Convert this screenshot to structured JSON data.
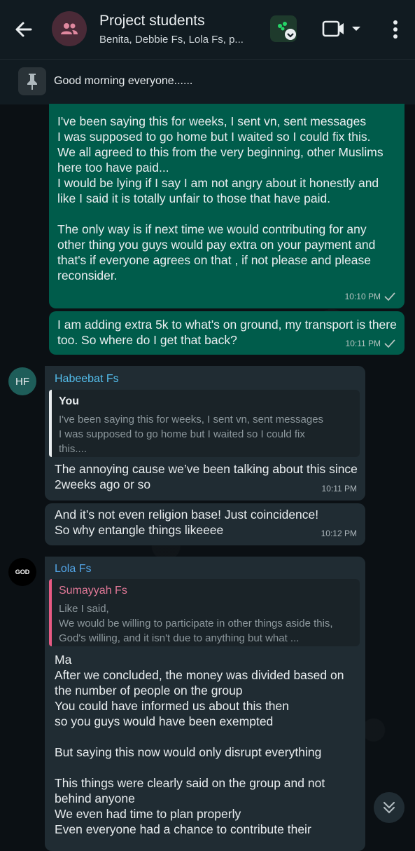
{
  "header": {
    "title": "Project students",
    "participants": "Benita, Debbie Fs, Lola Fs, p..."
  },
  "pinned": {
    "text": "Good morning everyone......"
  },
  "messages": {
    "out1": {
      "text": "I've been saying this for weeks, I sent vn, sent messages\nI was supposed to go home but I waited so I could fix this.\nWe all agreed to this from the very beginning, other Muslims here too have paid...\nI would be lying if I say I am not angry about it honestly and like I said it is totally unfair to those that have paid.\n\nThe only way is if next time we would contributing for any other thing you guys would pay extra on your payment and that's if everyone agrees on that , if not please and please reconsider.",
      "time": "10:10 PM"
    },
    "out2": {
      "text": "I am adding extra 5k to what's on ground, my transport is there too. So where do I get that back?",
      "time": "10:11 PM"
    },
    "in1": {
      "avatar": "HF",
      "sender": "Habeebat Fs",
      "quote_name": "You",
      "quote_text": "I've been saying this for weeks, I sent vn, sent messages\nI was supposed to go home but I waited so I could fix\nthis....",
      "text": "The annoying cause we’ve been talking about this since 2weeks ago or so",
      "time": "10:11 PM"
    },
    "in2": {
      "text": "And it’s not even religion base! Just coincidence!\nSo why entangle things likeeee",
      "time": "10:12 PM"
    },
    "in3": {
      "avatar": "GOD",
      "sender": "Lola Fs",
      "quote_name": "Sumayyah Fs",
      "quote_text": "Like I said,\nWe would be willing to participate in other things aside this, God's willing, and it isn't due to anything but what ...",
      "text": "Ma\nAfter we concluded, the money was divided based on the number of people on the group\nYou could have informed us about this then\nso you guys would have been exempted\n\nBut saying this now would only disrupt everything\n\nThis things were clearly said on the group and not behind anyone\nWe even had time to plan properly\nEven everyone had a chance to contribute their"
    }
  },
  "colors": {
    "outgoing_bubble": "#005c4b",
    "incoming_bubble": "#202c33",
    "habeebat_name": "#53bdeb",
    "lola_name": "#53a6e8",
    "sumayyah_quote": "#e75a83"
  }
}
